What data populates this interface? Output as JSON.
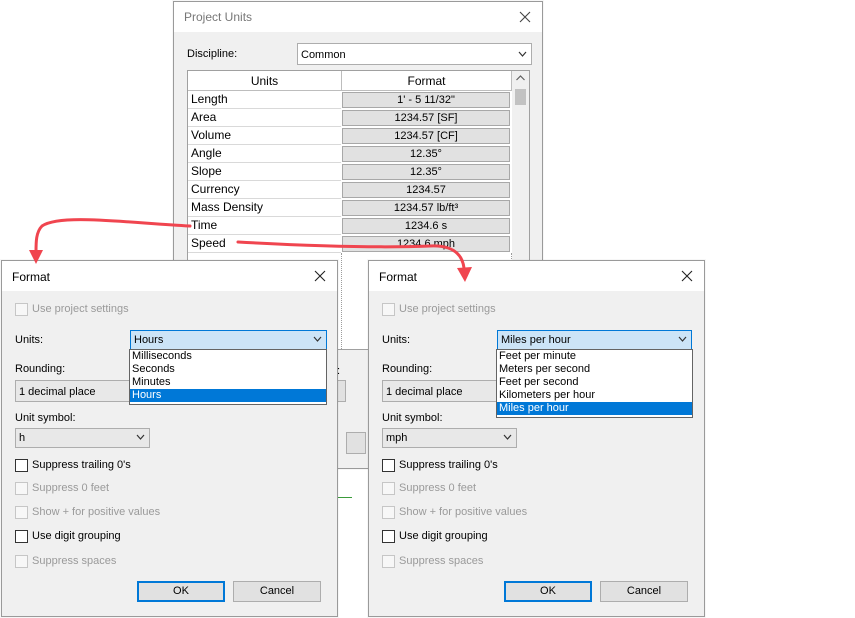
{
  "project_units": {
    "title": "Project Units",
    "discipline_label": "Discipline:",
    "discipline_value": "Common",
    "col_units": "Units",
    "col_format": "Format",
    "rows": [
      {
        "unit": "Length",
        "format": "1' - 5 11/32\""
      },
      {
        "unit": "Area",
        "format": "1234.57 [SF]"
      },
      {
        "unit": "Volume",
        "format": "1234.57 [CF]"
      },
      {
        "unit": "Angle",
        "format": "12.35°"
      },
      {
        "unit": "Slope",
        "format": "12.35°"
      },
      {
        "unit": "Currency",
        "format": "1234.57"
      },
      {
        "unit": "Mass Density",
        "format": "1234.57 lb/ft³"
      },
      {
        "unit": "Time",
        "format": "1234.6 s"
      },
      {
        "unit": "Speed",
        "format": "1234.6 mph"
      }
    ],
    "hidden_partial_label": ":"
  },
  "format_time": {
    "title": "Format",
    "use_project_settings": "Use project settings",
    "units_label": "Units:",
    "units_value": "Hours",
    "units_options": [
      "Milliseconds",
      "Seconds",
      "Minutes",
      "Hours"
    ],
    "selected_option": "Hours",
    "rounding_label": "Rounding:",
    "rounding_value": "1 decimal place",
    "unit_symbol_label": "Unit symbol:",
    "unit_symbol_value": "h",
    "suppress_trailing": "Suppress trailing 0's",
    "suppress_feet": "Suppress 0 feet",
    "show_plus": "Show + for positive values",
    "digit_grouping": "Use digit grouping",
    "suppress_spaces": "Suppress spaces",
    "ok": "OK",
    "cancel": "Cancel"
  },
  "format_speed": {
    "title": "Format",
    "use_project_settings": "Use project settings",
    "units_label": "Units:",
    "units_value": "Miles per hour",
    "units_options": [
      "Feet per minute",
      "Meters per second",
      "Feet per second",
      "Kilometers per hour",
      "Miles per hour"
    ],
    "selected_option": "Miles per hour",
    "rounding_label": "Rounding:",
    "rounding_value": "1 decimal place",
    "unit_symbol_label": "Unit symbol:",
    "unit_symbol_value": "mph",
    "suppress_trailing": "Suppress trailing 0's",
    "suppress_feet": "Suppress 0 feet",
    "show_plus": "Show + for positive values",
    "digit_grouping": "Use digit grouping",
    "suppress_spaces": "Suppress spaces",
    "ok": "OK",
    "cancel": "Cancel"
  },
  "colors": {
    "accent": "#0078d7",
    "annotation_arrow": "#f0454f",
    "dialog_bg": "#f0f0f0"
  },
  "icons": {
    "close": "close-icon",
    "dropdown": "chevron-down-icon",
    "arrow": "annotation-arrow"
  }
}
